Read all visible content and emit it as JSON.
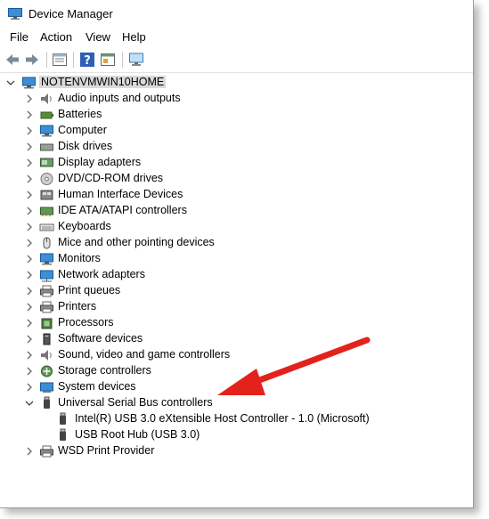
{
  "window": {
    "title": "Device Manager"
  },
  "menu": [
    "File",
    "Action",
    "View",
    "Help"
  ],
  "toolbar": {
    "icons": [
      "back-arrow-icon",
      "forward-arrow-icon",
      "properties-icon",
      "help-icon",
      "console-icon",
      "monitor-scan-icon"
    ]
  },
  "tree": {
    "root": "NOTENVMWIN10HOME",
    "categories": [
      {
        "label": "Audio inputs and outputs",
        "icon": "speaker-icon",
        "expanded": false
      },
      {
        "label": "Batteries",
        "icon": "battery-icon",
        "expanded": false
      },
      {
        "label": "Computer",
        "icon": "computer-icon",
        "expanded": false
      },
      {
        "label": "Disk drives",
        "icon": "disk-drive-icon",
        "expanded": false
      },
      {
        "label": "Display adapters",
        "icon": "display-adapter-icon",
        "expanded": false
      },
      {
        "label": "DVD/CD-ROM drives",
        "icon": "dvd-drive-icon",
        "expanded": false
      },
      {
        "label": "Human Interface Devices",
        "icon": "hid-icon",
        "expanded": false
      },
      {
        "label": "IDE ATA/ATAPI controllers",
        "icon": "ide-controller-icon",
        "expanded": false
      },
      {
        "label": "Keyboards",
        "icon": "keyboard-icon",
        "expanded": false
      },
      {
        "label": "Mice and other pointing devices",
        "icon": "mouse-icon",
        "expanded": false
      },
      {
        "label": "Monitors",
        "icon": "monitor-icon",
        "expanded": false
      },
      {
        "label": "Network adapters",
        "icon": "network-adapter-icon",
        "expanded": false
      },
      {
        "label": "Print queues",
        "icon": "print-queue-icon",
        "expanded": false
      },
      {
        "label": "Printers",
        "icon": "printer-icon",
        "expanded": false
      },
      {
        "label": "Processors",
        "icon": "processor-icon",
        "expanded": false
      },
      {
        "label": "Software devices",
        "icon": "software-device-icon",
        "expanded": false
      },
      {
        "label": "Sound, video and game controllers",
        "icon": "sound-icon",
        "expanded": false
      },
      {
        "label": "Storage controllers",
        "icon": "storage-controller-icon",
        "expanded": false
      },
      {
        "label": "System devices",
        "icon": "system-device-icon",
        "expanded": false
      },
      {
        "label": "Universal Serial Bus controllers",
        "icon": "usb-icon",
        "expanded": true,
        "children": [
          {
            "label": "Intel(R) USB 3.0 eXtensible Host Controller - 1.0 (Microsoft)",
            "icon": "usb-icon"
          },
          {
            "label": "USB Root Hub (USB 3.0)",
            "icon": "usb-icon"
          }
        ]
      },
      {
        "label": "WSD Print Provider",
        "icon": "printer-icon",
        "expanded": false
      }
    ]
  },
  "colors": {
    "annotation_arrow": "#e3221c",
    "selection": "#d9d9d9"
  }
}
